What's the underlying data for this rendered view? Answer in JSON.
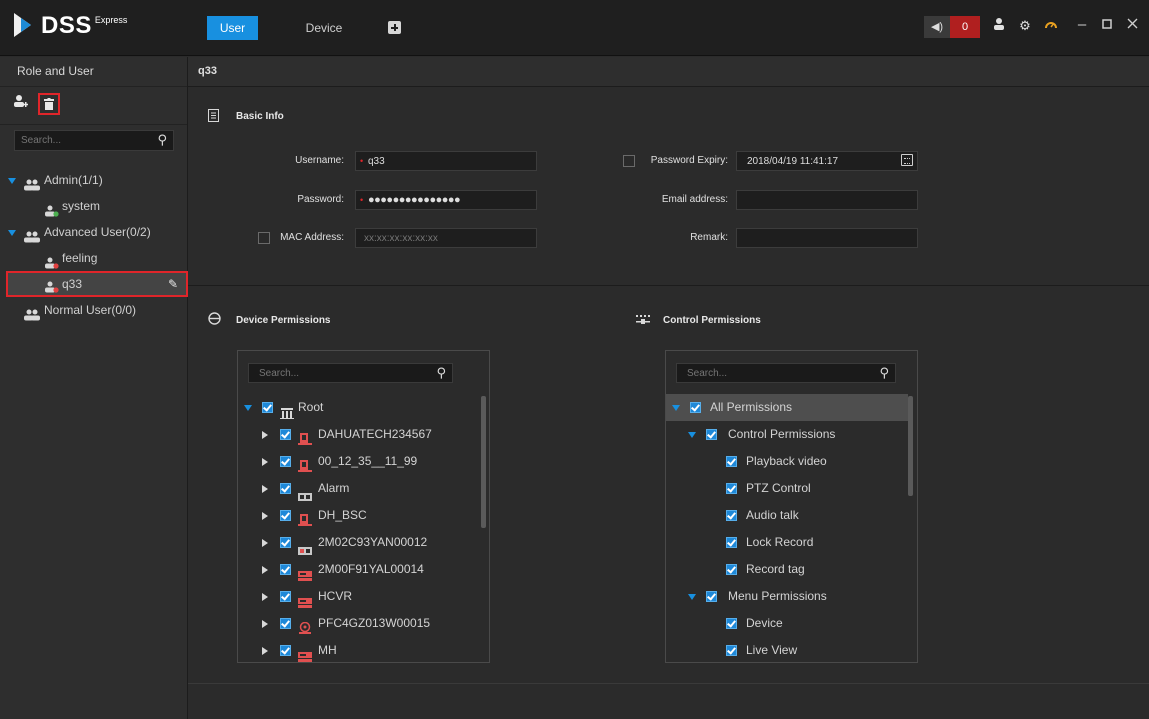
{
  "app": {
    "logo_text": "DSS",
    "logo_sup": "Express"
  },
  "tabs": [
    {
      "label": "User"
    },
    {
      "label": "Device"
    }
  ],
  "top_right": {
    "alarm_count": "0"
  },
  "left": {
    "title": "Role and User",
    "search_placeholder": "Search...",
    "tree": [
      {
        "label": "Admin(1/1)",
        "type": "group",
        "expanded": true
      },
      {
        "label": "system",
        "type": "user"
      },
      {
        "label": "Advanced User(0/2)",
        "type": "group",
        "expanded": true
      },
      {
        "label": "feeling",
        "type": "user"
      },
      {
        "label": "q33",
        "type": "user",
        "selected": true
      },
      {
        "label": "Normal User(0/0)",
        "type": "group"
      }
    ]
  },
  "main": {
    "title": "q33",
    "basic_info": {
      "title": "Basic Info",
      "username_label": "Username:",
      "username_value": "q33",
      "password_label": "Password:",
      "password_value": "●●●●●●●●●●●●●●●",
      "mac_label": "MAC Address:",
      "mac_placeholder": "xx:xx:xx:xx:xx:xx",
      "expiry_label": "Password Expiry:",
      "expiry_value": "2018/04/19 11:41:17",
      "email_label": "Email address:",
      "email_value": "",
      "remark_label": "Remark:",
      "remark_value": ""
    },
    "device_permissions": {
      "title": "Device Permissions",
      "search_placeholder": "Search...",
      "root": "Root",
      "items": [
        {
          "label": "DAHUATECH234567",
          "icon": "nvr-icon"
        },
        {
          "label": "00_12_35__11_99",
          "icon": "nvr-icon"
        },
        {
          "label": "Alarm",
          "icon": "alarm-host-icon"
        },
        {
          "label": "DH_BSC",
          "icon": "nvr-icon"
        },
        {
          "label": "2M02C93YAN00012",
          "icon": "alarm-host-icon"
        },
        {
          "label": "2M00F91YAL00014",
          "icon": "dvr-icon"
        },
        {
          "label": "HCVR",
          "icon": "dvr-icon"
        },
        {
          "label": "PFC4GZ013W00015",
          "icon": "access-icon"
        },
        {
          "label": "MH",
          "icon": "dvr-icon"
        }
      ]
    },
    "control_permissions": {
      "title": "Control Permissions",
      "search_placeholder": "Search...",
      "root": "All Permissions",
      "group1": "Control Permissions",
      "group1_items": [
        "Playback video",
        "PTZ Control",
        "Audio talk",
        "Lock Record",
        "Record tag"
      ],
      "group2": "Menu Permissions",
      "group2_items": [
        "Device",
        "Live View"
      ]
    }
  },
  "colors": {
    "accent": "#1890e0",
    "highlight": "#e0252a",
    "background": "#2b2b2b"
  }
}
